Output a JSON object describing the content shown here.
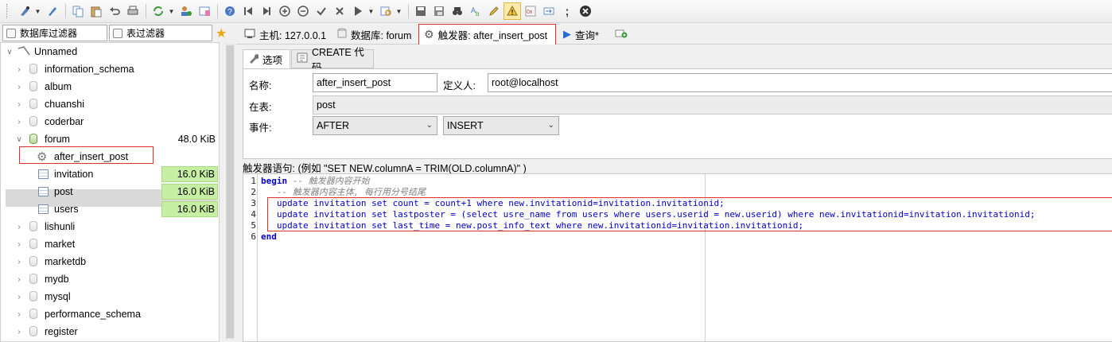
{
  "toolbar": {
    "icons": [
      "connection-icon",
      "dropdown",
      "plug-icon",
      "copy-icon",
      "paste-icon",
      "undo-icon",
      "print-icon",
      "refresh-icon",
      "dropdown",
      "user-manager-icon",
      "import-icon",
      "help-icon",
      "first-icon",
      "prev-icon",
      "add-icon",
      "remove-icon",
      "check-icon",
      "cancel-icon",
      "run-icon",
      "dropdown",
      "query-icon",
      "dropdown",
      "save-icon",
      "save-as-icon",
      "binoculars-icon",
      "translate-icon",
      "edit-icon",
      "warning-icon",
      "hex-icon",
      "wrap-icon",
      "semicolon-icon",
      "stop-icon"
    ]
  },
  "filters": {
    "db_filter": "数据库过滤器",
    "table_filter": "表过滤器"
  },
  "tree": {
    "root": "Unnamed",
    "databases": [
      {
        "name": "information_schema"
      },
      {
        "name": "album"
      },
      {
        "name": "chuanshi"
      },
      {
        "name": "coderbar"
      },
      {
        "name": "forum",
        "size": "48.0 KiB"
      }
    ],
    "forum_children": [
      {
        "name": "after_insert_post"
      },
      {
        "name": "invitation",
        "size": "16.0 KiB"
      },
      {
        "name": "post",
        "size": "16.0 KiB"
      },
      {
        "name": "users",
        "size": "16.0 KiB"
      }
    ],
    "more_databases": [
      "lishunli",
      "market",
      "marketdb",
      "mydb",
      "mysql",
      "performance_schema",
      "register"
    ]
  },
  "tabs": {
    "host": "主机: 127.0.0.1",
    "database": "数据库: forum",
    "trigger": "触发器: after_insert_post",
    "query": "查询*"
  },
  "subtabs": {
    "options": "选项",
    "create_code": "CREATE 代码"
  },
  "form": {
    "name_label": "名称:",
    "name_value": "after_insert_post",
    "definer_label": "定义人:",
    "definer_value": "root@localhost",
    "table_label": "在表:",
    "table_value": "post",
    "event_label": "事件:",
    "timing_value": "AFTER",
    "event_value": "INSERT"
  },
  "trigger_statement_label": "触发器语句:  (例如 \"SET NEW.columnA = TRIM(OLD.columnA)\" )",
  "code": {
    "line_numbers": [
      "1",
      "2",
      "3",
      "4",
      "5",
      "6"
    ],
    "line1_kw": "begin",
    "line1_comment": " -- 触发器内容开始",
    "line2_comment": "   -- 触发器内容主体, 每行用分号结尾",
    "line3": "   update invitation set count = count+1 where new.invitationid=invitation.invitationid;",
    "line4": "   update invitation set lastposter = (select usre_name from users where users.userid = new.userid) where new.invitationid=invitation.invitationid;",
    "line5": "   update invitation set last_time = new.post_info_text where new.invitationid=invitation.invitationid;",
    "line6_kw": "end"
  }
}
